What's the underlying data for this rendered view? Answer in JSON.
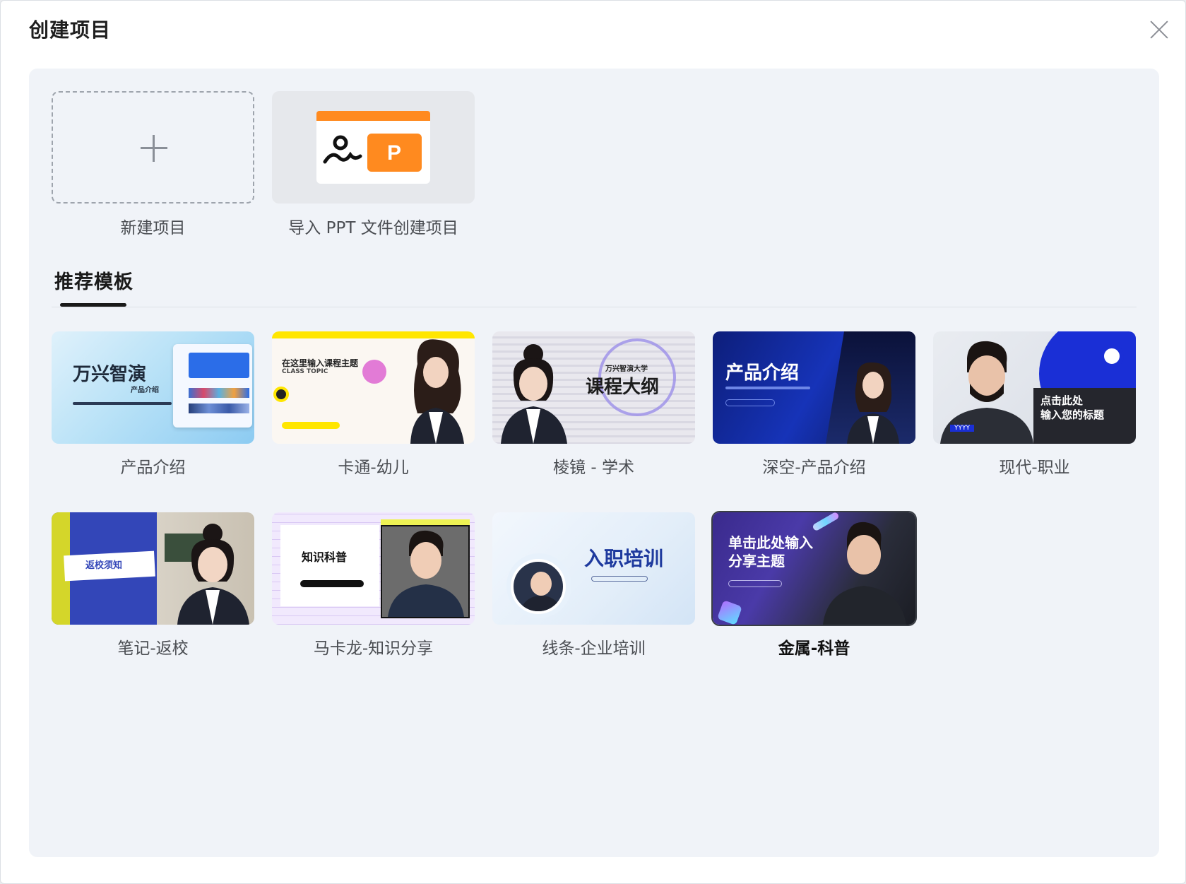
{
  "dialog": {
    "title": "创建项目",
    "close_icon": "close-icon"
  },
  "actions": {
    "new_project_label": "新建项目",
    "import_label": "导入 PPT 文件创建项目",
    "ppt_letter": "P"
  },
  "tabs": {
    "recommended": "推荐模板"
  },
  "colors": {
    "accent_orange": "#ff8a1f",
    "panel_bg": "#f0f3f8"
  },
  "templates": [
    {
      "label": "产品介绍",
      "thumb_title": "万兴智演",
      "thumb_sub": "产品介绍"
    },
    {
      "label": "卡通-幼儿",
      "thumb_title": "在这里输入课程主题",
      "thumb_sub": "CLASS TOPIC"
    },
    {
      "label": "棱镜 - 学术",
      "thumb_title": "课程大纲",
      "thumb_sub": "万兴智演大学"
    },
    {
      "label": "深空-产品介绍",
      "thumb_title": "产品介绍"
    },
    {
      "label": "现代-职业",
      "thumb_title": "点击此处\n输入您的标题",
      "thumb_tag": "YYYY"
    },
    {
      "label": "笔记-返校",
      "thumb_title": "返校须知"
    },
    {
      "label": "马卡龙-知识分享",
      "thumb_title": "知识科普"
    },
    {
      "label": "线条-企业培训",
      "thumb_title": "入职培训"
    },
    {
      "label": "金属-科普",
      "thumb_title": "单击此处输入\n分享主题"
    }
  ]
}
